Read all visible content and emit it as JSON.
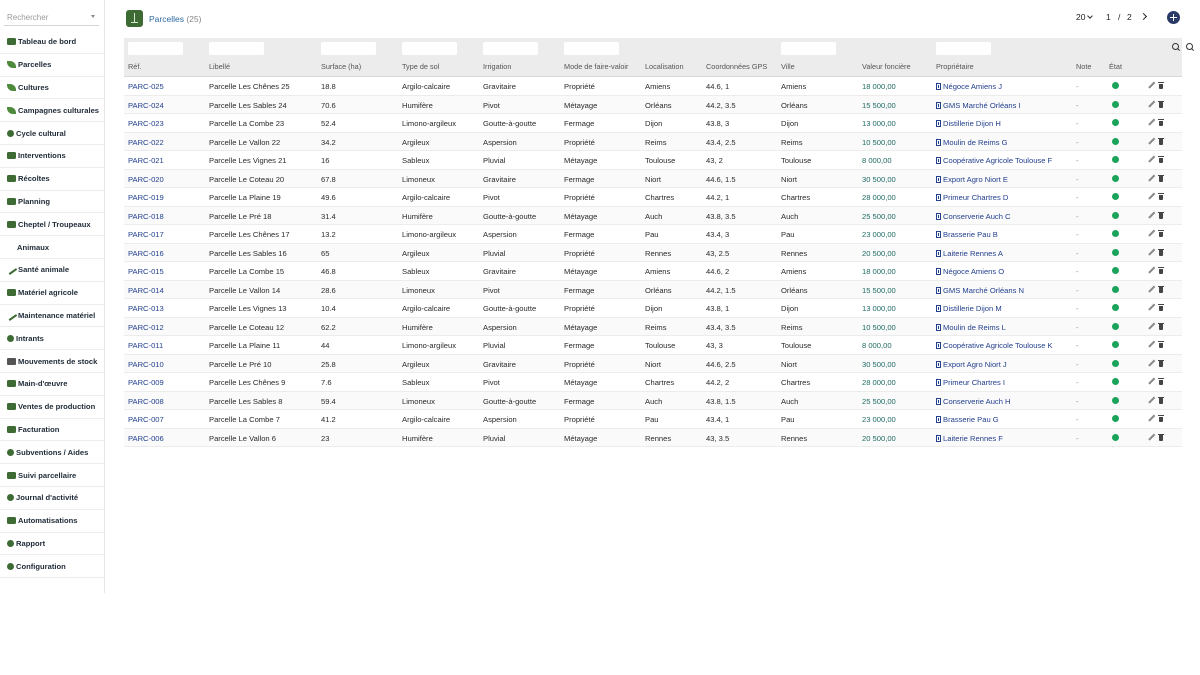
{
  "search": {
    "placeholder": "Rechercher"
  },
  "sidebar": {
    "items": [
      {
        "label": "Tableau de bord",
        "name": "sidebar-item-tableau-de-bord",
        "icon": "dashboard-icon"
      },
      {
        "label": "Parcelles",
        "name": "sidebar-item-parcelles",
        "icon": "map-icon"
      },
      {
        "label": "Cultures",
        "name": "sidebar-item-cultures",
        "icon": "sprout-icon"
      },
      {
        "label": "Campagnes culturales",
        "name": "sidebar-item-campagnes-culturales",
        "icon": "leaf-icon"
      },
      {
        "label": "Cycle cultural",
        "name": "sidebar-item-cycle-cultural",
        "icon": "cycle-icon"
      },
      {
        "label": "Interventions",
        "name": "sidebar-item-interventions",
        "icon": "tractor-icon"
      },
      {
        "label": "Récoltes",
        "name": "sidebar-item-recoltes",
        "icon": "basket-icon"
      },
      {
        "label": "Planning",
        "name": "sidebar-item-planning",
        "icon": "calendar-icon"
      },
      {
        "label": "Cheptel / Troupeaux",
        "name": "sidebar-item-cheptel-troupeaux",
        "icon": "cow-icon"
      },
      {
        "label": "Animaux",
        "name": "sidebar-item-animaux",
        "icon": "",
        "sub": true
      },
      {
        "label": "Santé animale",
        "name": "sidebar-item-sante-animale",
        "icon": "syringe-icon"
      },
      {
        "label": "Matériel agricole",
        "name": "sidebar-item-materiel-agricole",
        "icon": "tractor-icon"
      },
      {
        "label": "Maintenance matériel",
        "name": "sidebar-item-maintenance-materiel",
        "icon": "wrench-icon"
      },
      {
        "label": "Intrants",
        "name": "sidebar-item-intrants",
        "icon": "seed-icon"
      },
      {
        "label": "Mouvements de stock",
        "name": "sidebar-item-mouvements-de-stock",
        "icon": "swap-icon"
      },
      {
        "label": "Main-d'œuvre",
        "name": "sidebar-item-main-doeuvre",
        "icon": "person-icon"
      },
      {
        "label": "Ventes de production",
        "name": "sidebar-item-ventes-de-production",
        "icon": "handshake-icon"
      },
      {
        "label": "Facturation",
        "name": "sidebar-item-facturation",
        "icon": "invoice-icon"
      },
      {
        "label": "Subventions / Aides",
        "name": "sidebar-item-subventions-aides",
        "icon": "medal-icon"
      },
      {
        "label": "Suivi parcellaire",
        "name": "sidebar-item-suivi-parcellaire",
        "icon": "truck-icon"
      },
      {
        "label": "Journal d'activité",
        "name": "sidebar-item-journal-dactivite",
        "icon": "history-icon"
      },
      {
        "label": "Automatisations",
        "name": "sidebar-item-automatisations",
        "icon": "robot-icon"
      },
      {
        "label": "Rapport",
        "name": "sidebar-item-rapport",
        "icon": "chart-icon"
      },
      {
        "label": "Configuration",
        "name": "sidebar-item-configuration",
        "icon": "gear-icon"
      }
    ]
  },
  "header": {
    "title": "Parcelles",
    "count": "(25)"
  },
  "pager": {
    "per_page": "20",
    "current": "1",
    "sep": "/",
    "total": "2"
  },
  "table": {
    "columns": [
      {
        "key": "ref",
        "label": "Réf.",
        "filter": true
      },
      {
        "key": "label",
        "label": "Libellé",
        "filter": true
      },
      {
        "key": "surface",
        "label": "Surface (ha)",
        "filter": true
      },
      {
        "key": "soil",
        "label": "Type de sol",
        "filter": true
      },
      {
        "key": "irrigation",
        "label": "Irrigation",
        "filter": true
      },
      {
        "key": "tenure",
        "label": "Mode de faire-valoir",
        "filter": true
      },
      {
        "key": "location",
        "label": "Localisation",
        "filter": false
      },
      {
        "key": "gps",
        "label": "Coordonnées GPS",
        "filter": false
      },
      {
        "key": "city",
        "label": "Ville",
        "filter": true
      },
      {
        "key": "value",
        "label": "Valeur foncière",
        "filter": false
      },
      {
        "key": "owner",
        "label": "Propriétaire",
        "filter": true
      },
      {
        "key": "note",
        "label": "Note",
        "filter": false
      },
      {
        "key": "state",
        "label": "État",
        "filter": false
      }
    ],
    "rows": [
      [
        "PARC-025",
        "Parcelle Les Chênes 25",
        "18.8",
        "Argilo-calcaire",
        "Gravitaire",
        "Propriété",
        "Amiens",
        "44.6, 1",
        "Amiens",
        "18 000,00",
        "Négoce Amiens J",
        "-"
      ],
      [
        "PARC-024",
        "Parcelle Les Sables 24",
        "70.6",
        "Humifère",
        "Pivot",
        "Métayage",
        "Orléans",
        "44.2, 3.5",
        "Orléans",
        "15 500,00",
        "GMS Marché Orléans I",
        "-"
      ],
      [
        "PARC-023",
        "Parcelle La Combe 23",
        "52.4",
        "Limono-argileux",
        "Goutte-à-goutte",
        "Fermage",
        "Dijon",
        "43.8, 3",
        "Dijon",
        "13 000,00",
        "Distillerie Dijon H",
        "-"
      ],
      [
        "PARC-022",
        "Parcelle Le Vallon 22",
        "34.2",
        "Argileux",
        "Aspersion",
        "Propriété",
        "Reims",
        "43.4, 2.5",
        "Reims",
        "10 500,00",
        "Moulin de Reims G",
        "-"
      ],
      [
        "PARC-021",
        "Parcelle Les Vignes 21",
        "16",
        "Sableux",
        "Pluvial",
        "Métayage",
        "Toulouse",
        "43, 2",
        "Toulouse",
        "8 000,00",
        "Coopérative Agricole Toulouse F",
        "-"
      ],
      [
        "PARC-020",
        "Parcelle Le Coteau 20",
        "67.8",
        "Limoneux",
        "Gravitaire",
        "Fermage",
        "Niort",
        "44.6, 1.5",
        "Niort",
        "30 500,00",
        "Export Agro Niort E",
        "-"
      ],
      [
        "PARC-019",
        "Parcelle La Plaine 19",
        "49.6",
        "Argilo-calcaire",
        "Pivot",
        "Propriété",
        "Chartres",
        "44.2, 1",
        "Chartres",
        "28 000,00",
        "Primeur Chartres D",
        "-"
      ],
      [
        "PARC-018",
        "Parcelle Le Pré 18",
        "31.4",
        "Humifère",
        "Goutte-à-goutte",
        "Métayage",
        "Auch",
        "43.8, 3.5",
        "Auch",
        "25 500,00",
        "Conserverie Auch C",
        "-"
      ],
      [
        "PARC-017",
        "Parcelle Les Chênes 17",
        "13.2",
        "Limono-argileux",
        "Aspersion",
        "Fermage",
        "Pau",
        "43.4, 3",
        "Pau",
        "23 000,00",
        "Brasserie Pau B",
        "-"
      ],
      [
        "PARC-016",
        "Parcelle Les Sables 16",
        "65",
        "Argileux",
        "Pluvial",
        "Propriété",
        "Rennes",
        "43, 2.5",
        "Rennes",
        "20 500,00",
        "Laiterie Rennes A",
        "-"
      ],
      [
        "PARC-015",
        "Parcelle La Combe 15",
        "46.8",
        "Sableux",
        "Gravitaire",
        "Métayage",
        "Amiens",
        "44.6, 2",
        "Amiens",
        "18 000,00",
        "Négoce Amiens O",
        "-"
      ],
      [
        "PARC-014",
        "Parcelle Le Vallon 14",
        "28.6",
        "Limoneux",
        "Pivot",
        "Fermage",
        "Orléans",
        "44.2, 1.5",
        "Orléans",
        "15 500,00",
        "GMS Marché Orléans N",
        "-"
      ],
      [
        "PARC-013",
        "Parcelle Les Vignes 13",
        "10.4",
        "Argilo-calcaire",
        "Goutte-à-goutte",
        "Propriété",
        "Dijon",
        "43.8, 1",
        "Dijon",
        "13 000,00",
        "Distillerie Dijon M",
        "-"
      ],
      [
        "PARC-012",
        "Parcelle Le Coteau 12",
        "62.2",
        "Humifère",
        "Aspersion",
        "Métayage",
        "Reims",
        "43.4, 3.5",
        "Reims",
        "10 500,00",
        "Moulin de Reims L",
        "-"
      ],
      [
        "PARC-011",
        "Parcelle La Plaine 11",
        "44",
        "Limono-argileux",
        "Pluvial",
        "Fermage",
        "Toulouse",
        "43, 3",
        "Toulouse",
        "8 000,00",
        "Coopérative Agricole Toulouse K",
        "-"
      ],
      [
        "PARC-010",
        "Parcelle Le Pré 10",
        "25.8",
        "Argileux",
        "Gravitaire",
        "Propriété",
        "Niort",
        "44.6, 2.5",
        "Niort",
        "30 500,00",
        "Export Agro Niort J",
        "-"
      ],
      [
        "PARC-009",
        "Parcelle Les Chênes 9",
        "7.6",
        "Sableux",
        "Pivot",
        "Métayage",
        "Chartres",
        "44.2, 2",
        "Chartres",
        "28 000,00",
        "Primeur Chartres I",
        "-"
      ],
      [
        "PARC-008",
        "Parcelle Les Sables 8",
        "59.4",
        "Limoneux",
        "Goutte-à-goutte",
        "Fermage",
        "Auch",
        "43.8, 1.5",
        "Auch",
        "25 500,00",
        "Conserverie Auch H",
        "-"
      ],
      [
        "PARC-007",
        "Parcelle La Combe 7",
        "41.2",
        "Argilo-calcaire",
        "Aspersion",
        "Propriété",
        "Pau",
        "43.4, 1",
        "Pau",
        "23 000,00",
        "Brasserie Pau G",
        "-"
      ],
      [
        "PARC-006",
        "Parcelle Le Vallon 6",
        "23",
        "Humifère",
        "Pluvial",
        "Métayage",
        "Rennes",
        "43, 3.5",
        "Rennes",
        "20 500,00",
        "Laiterie Rennes F",
        "-"
      ]
    ],
    "status_color": "#1aa35a"
  },
  "colors": {
    "accent": "#3e6b34",
    "link": "#23408e",
    "value": "#1d6a64",
    "add_button": "#2a3a66"
  }
}
